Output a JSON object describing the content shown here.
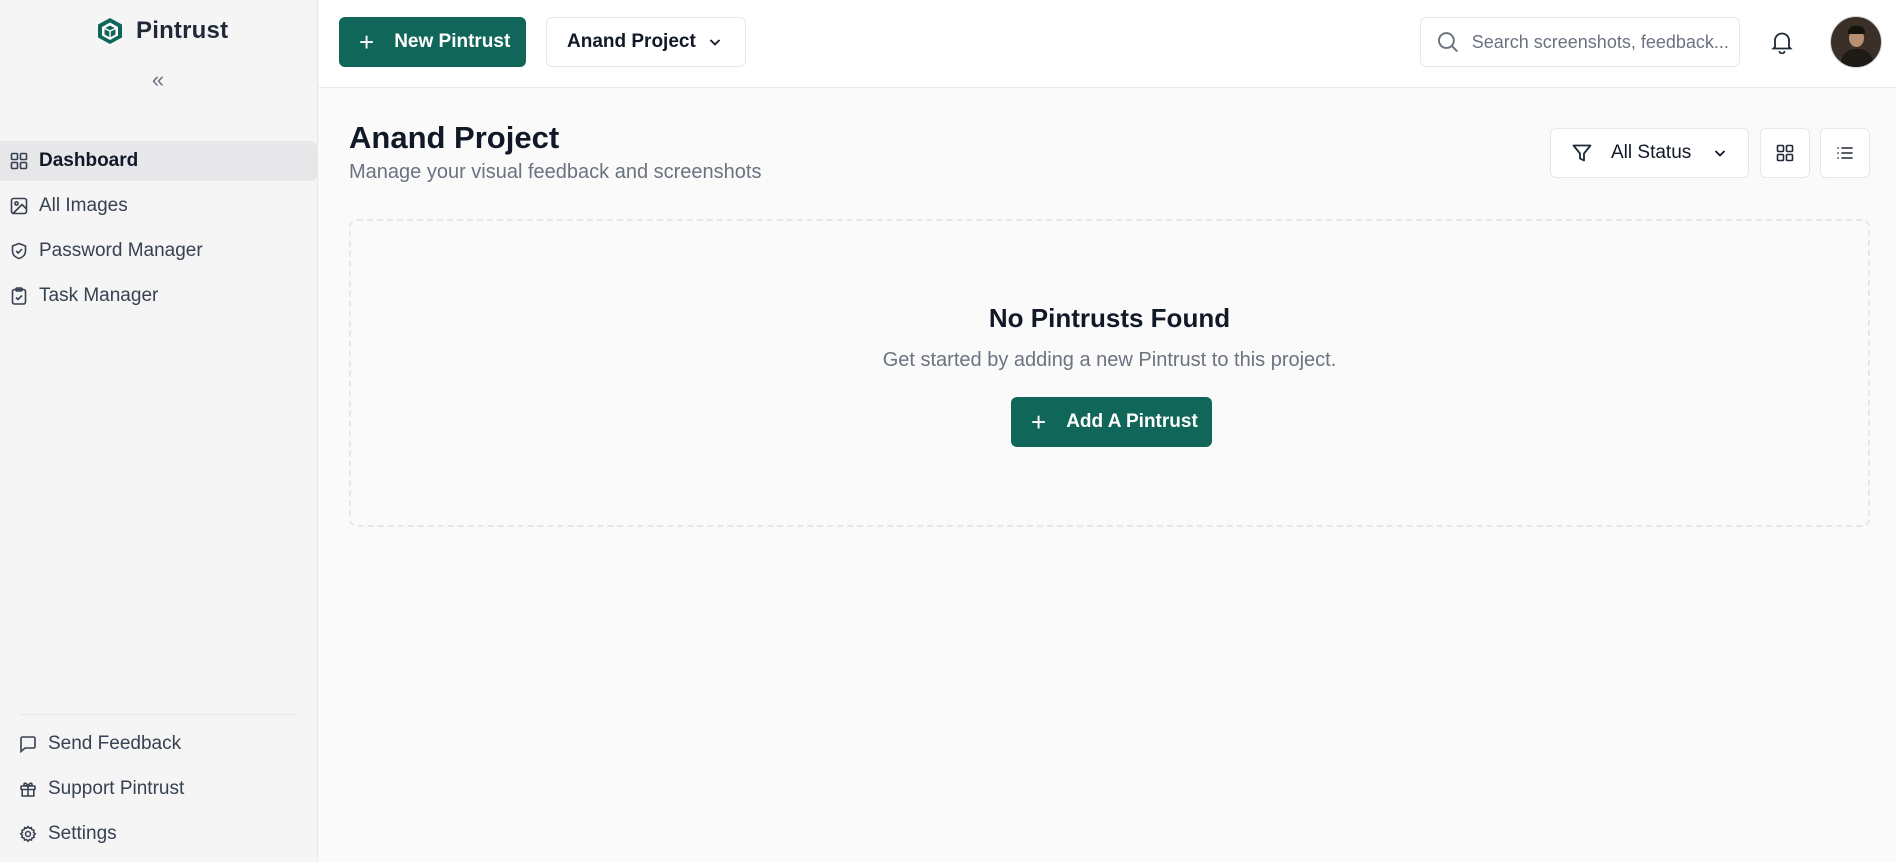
{
  "app": {
    "name": "Pintrust",
    "brand_color": "#11665a"
  },
  "sidebar": {
    "collapse_glyph": "«",
    "items": [
      {
        "label": "Dashboard",
        "icon": "dashboard-grid-icon",
        "active": true
      },
      {
        "label": "All Images",
        "icon": "image-icon",
        "active": false
      },
      {
        "label": "Password Manager",
        "icon": "shield-check-icon",
        "active": false
      },
      {
        "label": "Task Manager",
        "icon": "clipboard-check-icon",
        "active": false
      }
    ],
    "bottom_items": [
      {
        "label": "Send Feedback",
        "icon": "message-square-icon"
      },
      {
        "label": "Support Pintrust",
        "icon": "gift-icon"
      },
      {
        "label": "Settings",
        "icon": "gear-icon"
      }
    ]
  },
  "topbar": {
    "new_button_label": "New Pintrust",
    "project_selector": "Anand Project",
    "search_placeholder": "Search screenshots, feedback...",
    "notifications_icon": "bell-icon",
    "avatar": "user-avatar"
  },
  "main": {
    "title": "Anand Project",
    "subtitle": "Manage your visual feedback and screenshots",
    "status_filter": "All Status",
    "view_modes": [
      "grid",
      "list"
    ],
    "empty_state": {
      "title": "No Pintrusts Found",
      "message": "Get started by adding a new Pintrust to this project.",
      "button_label": "Add A Pintrust"
    }
  }
}
